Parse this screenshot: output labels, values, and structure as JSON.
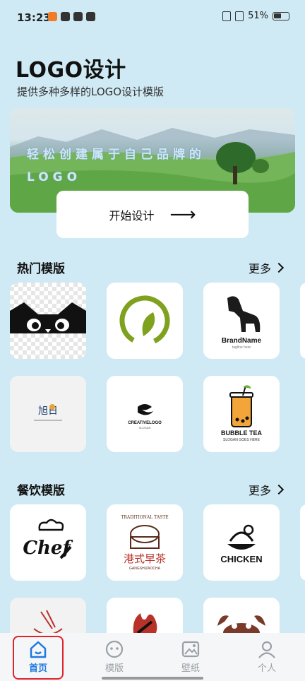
{
  "status": {
    "time": "13:23",
    "battery": "51%"
  },
  "header": {
    "title": "LOGO设计",
    "subtitle": "提供多种多样的LOGO设计模版"
  },
  "banner": {
    "text": "轻松创建属于自己品牌的LOGO",
    "button": "开始设计"
  },
  "sections": {
    "hot": {
      "title": "热门模版",
      "more": "更多"
    },
    "food": {
      "title": "餐饮模版",
      "more": "更多"
    }
  },
  "logos": {
    "brandname": "BrandName",
    "brandname_tag": "tagline here",
    "xuri": "旭日",
    "creative": "CREATIVELOGO",
    "creative_sub": "SLOGAN",
    "bubble": "BUBBLE TEA",
    "bubble_sub": "SLOGAN GOES HERE",
    "chef": "Chef",
    "traditional": "TRADITIONAL TASTE",
    "zaocha": "港式早茶",
    "zaocha_sub": "GANGSHIZAOCHA",
    "chicken": "CHICKEN"
  },
  "nav": [
    {
      "label": "首页",
      "icon": "home-icon"
    },
    {
      "label": "模版",
      "icon": "template-icon"
    },
    {
      "label": "壁纸",
      "icon": "wallpaper-icon"
    },
    {
      "label": "个人",
      "icon": "profile-icon"
    }
  ],
  "colors": {
    "accent": "#1e79e0",
    "background": "#cfeaf4",
    "highlight": "#e0222b"
  }
}
